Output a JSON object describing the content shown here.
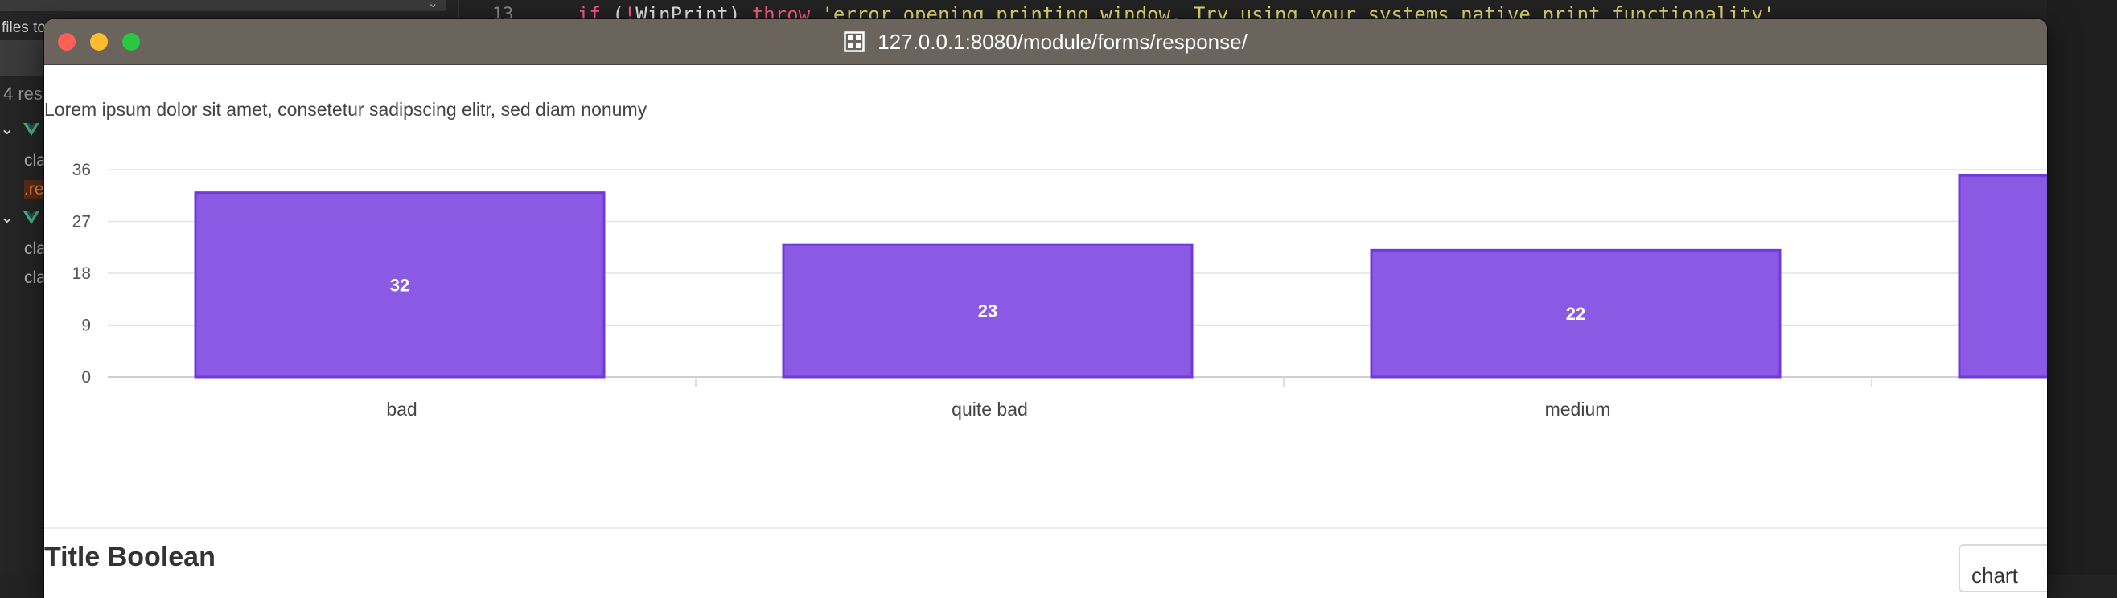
{
  "editor": {
    "files_label": "files to",
    "results_label": "4 res",
    "tree": [
      {
        "text": "cla"
      },
      {
        "text": ".re"
      },
      {
        "text": "cla"
      },
      {
        "text": "cla"
      }
    ],
    "line_number": "13",
    "code": {
      "kw_if": "if",
      "paren_open": " (",
      "not": "!",
      "ident": "WinPrint",
      "paren_close": ") ",
      "kw_throw": "throw",
      "string": " 'error opening printing window. Try using your systems native print functionality'"
    }
  },
  "browser": {
    "url": "127.0.0.1:8080/module/forms/response/"
  },
  "page": {
    "intro_text": "Lorem ipsum dolor sit amet, consetetur sadipscing elitr, sed diam nonumy",
    "section_title": "Title Boolean",
    "chart_button_label": "chart"
  },
  "colors": {
    "bar_fill": "#8a5ae4",
    "bar_border": "#7239d8",
    "titlebar": "#6b645d"
  },
  "chart_data": {
    "type": "bar",
    "categories": [
      "bad",
      "quite bad",
      "medium",
      ""
    ],
    "values": [
      32,
      23,
      22,
      35
    ],
    "data_labels": [
      "32",
      "23",
      "22",
      ""
    ],
    "yticks": [
      "0",
      "9",
      "18",
      "27",
      "36"
    ],
    "ylim": [
      0,
      36
    ],
    "title": "",
    "xlabel": "",
    "ylabel": "",
    "grid": true
  }
}
